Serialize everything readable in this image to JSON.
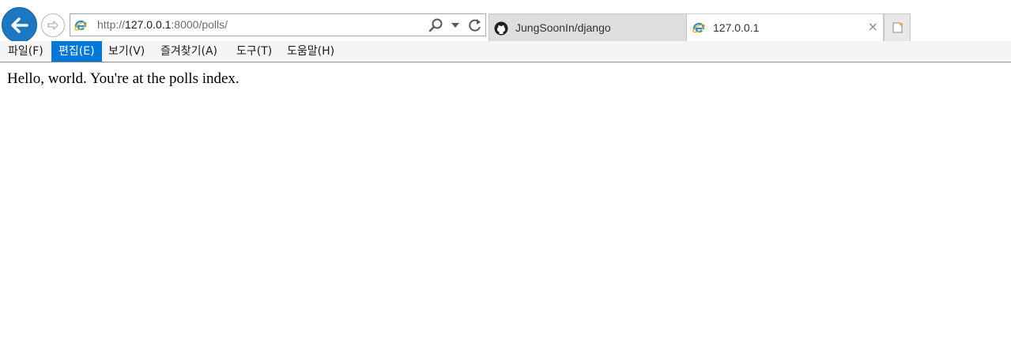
{
  "address_bar": {
    "url_prefix": "http://",
    "url_host": "127.0.0.1",
    "url_rest": ":8000/polls/"
  },
  "tabs": [
    {
      "label": "JungSoonIn/django",
      "icon": "github-icon",
      "active": false
    },
    {
      "label": "127.0.0.1",
      "icon": "ie-icon",
      "active": true
    }
  ],
  "tab_close_glyph": "×",
  "menu": [
    {
      "label": "파일(F)"
    },
    {
      "label": "편집(E)",
      "selected": true
    },
    {
      "label": "보기(V)"
    },
    {
      "label": "즐겨찾기(A)"
    },
    {
      "label": "도구(T)"
    },
    {
      "label": "도움말(H)"
    }
  ],
  "page": {
    "body_text": "Hello, world. You're at the polls index."
  },
  "colors": {
    "accent": "#1d78c1",
    "menu_selected": "#0078d7"
  }
}
